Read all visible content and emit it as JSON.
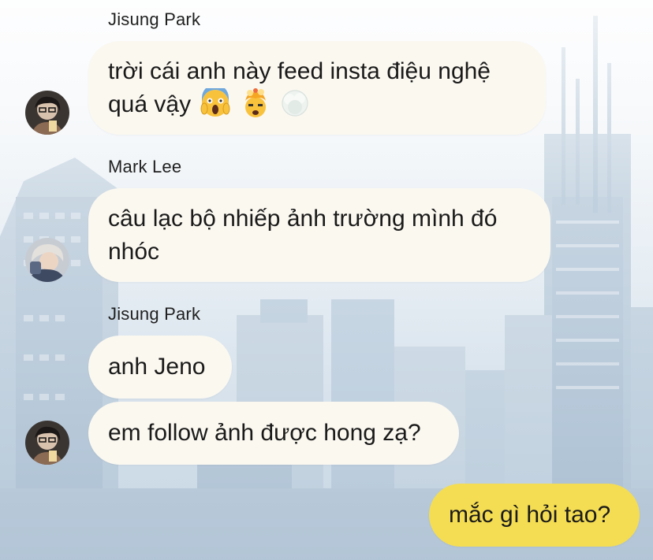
{
  "messages": [
    {
      "sender": "Jisung Park",
      "avatar_icon": "jisung-avatar",
      "text_line1": "trời cái anh này feed insta điệu nghệ",
      "text_line2": "quá vậy",
      "emojis": [
        "face-screaming-in-fear-emoji",
        "exploding-head-emoji",
        "fog-emoji"
      ]
    },
    {
      "sender": "Mark Lee",
      "avatar_icon": "mark-avatar",
      "text_line1": "câu lạc bộ nhiếp ảnh trường mình đó",
      "text_line2": "nhóc"
    },
    {
      "sender": "Jisung Park",
      "avatar_icon": "jisung-avatar",
      "text_a": "anh Jeno",
      "text_b": "em follow ảnh được hong zạ?"
    }
  ],
  "my_message": {
    "text": "mắc gì hỏi tao?"
  },
  "colors": {
    "incoming_bubble": "#fbf8f0",
    "outgoing_bubble": "#f4dd52"
  }
}
